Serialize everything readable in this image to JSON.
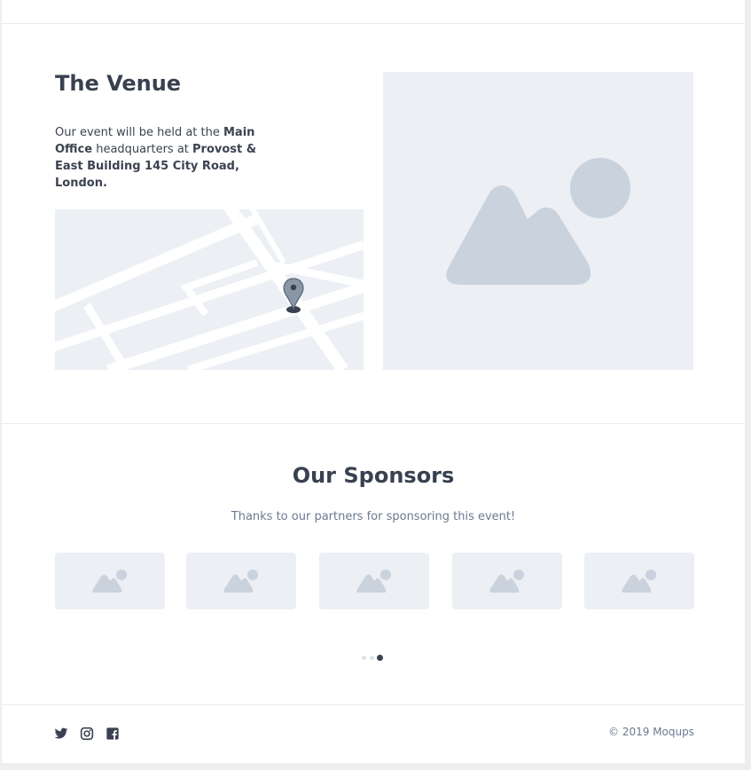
{
  "venue": {
    "title": "The Venue",
    "desc_1": "Our event will be held at the ",
    "desc_2": "Main Office",
    "desc_3": " headquarters at ",
    "desc_4": "Provost & East Building 145 City Road, London."
  },
  "sponsors": {
    "title": "Our Sponsors",
    "subtitle": "Thanks to our partners for sponsoring this event!",
    "logos": [
      "sponsor-logo-1",
      "sponsor-logo-2",
      "sponsor-logo-3",
      "sponsor-logo-4",
      "sponsor-logo-5"
    ],
    "carousel": {
      "pages": 3,
      "active": 3
    }
  },
  "footer": {
    "social": [
      "twitter-icon",
      "instagram-icon",
      "facebook-icon"
    ],
    "copyright": "© 2019  Moqups"
  },
  "colors": {
    "placeholder_bg": "#eceff3",
    "placeholder_shape": "#c9d2dd",
    "heading": "#394150",
    "muted_text": "#6b7a90"
  }
}
